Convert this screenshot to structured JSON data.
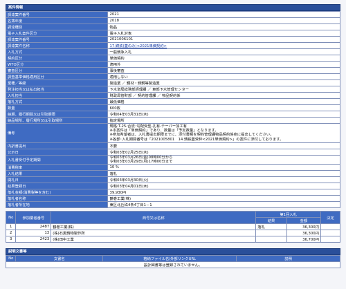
{
  "info": {
    "title": "案件情報",
    "rows": [
      {
        "label": "調達案件番号",
        "value": "2021"
      },
      {
        "label": "名簿年度",
        "value": "2018"
      },
      {
        "label": "調達種別",
        "value": "物品"
      },
      {
        "label": "電子入札案件区分",
        "value": "電子入札対象"
      },
      {
        "label": "調達案件番号",
        "value": "2021006101"
      },
      {
        "label": "調達案件名称",
        "value": "17.鋳鉄(蓋のみ)<2021単価契約>"
      },
      {
        "label": "入札方式",
        "value": "一般競争入札"
      },
      {
        "label": "契約区分",
        "value": "単価契約"
      },
      {
        "label": "WTO区分",
        "value": "適用外"
      },
      {
        "label": "審査区分",
        "value": "事後審査"
      },
      {
        "label": "調査基準価格適用区分",
        "value": "適用しない"
      },
      {
        "label": "業種／等級",
        "value": "製造業 ／ 鋼材・鋳鋼等製造業"
      },
      {
        "label": "発注担当又は払出担当",
        "value": "下水道局総務部経理課 ／ 東部下水管理センター"
      },
      {
        "label": "入札担当",
        "value": "財政局管財部 ／ 契約管理課 ／ 物品契約係"
      },
      {
        "label": "落札方式",
        "value": "最低価格"
      },
      {
        "label": "数量",
        "value": "600枚"
      },
      {
        "label": "納期、履行期間又は引取期限",
        "value": "令和04年03月31日(木)"
      },
      {
        "label": "納品場所、履行場所又は引取場所",
        "value": "指定場所"
      }
    ],
    "remarks": {
      "label": "備考",
      "lines": [
        "規格:T-25-合流･勾配受型-孔有-テーパー加工有",
        "※本案件は「単価契約」であり、数量は「予定数量」となります。",
        "※参加希望者は、入札書提出期限までに、添付書類を契約管理課物品契約係宛に提出してください。",
        "※各部･入札期間番号は「2021005801　14.鋳鉄蓋受枠<2021単価契約>」の案件に添付しております。"
      ]
    },
    "rows2": [
      {
        "label": "内訳書提出",
        "value": "不要"
      },
      {
        "label": "公示日",
        "value": "令和03年02月25日(木)"
      }
    ],
    "submission": {
      "label": "入札書受付予定期間",
      "lines": [
        "令和03年03月26日(金)08時00分から",
        "令和03年03月29日(月)17時00分まで"
      ]
    },
    "rows3": [
      {
        "label": "消費税率",
        "value": "10 %"
      },
      {
        "label": "入札結果",
        "value": "落札"
      },
      {
        "label": "開札日",
        "value": "令和03年03月30日(火)"
      },
      {
        "label": "結果登録日",
        "value": "令和03年04月01日(木)"
      },
      {
        "label": "落札金額(消費税等を含む)",
        "value": "39,930円"
      },
      {
        "label": "落札者名称",
        "value": "鶴巻工業(株)"
      },
      {
        "label": "落札者所在地",
        "value": "東区北丘珠4条4丁目1－1"
      }
    ]
  },
  "bids": {
    "headers": {
      "no": "No",
      "reg": "参加業者番号",
      "name": "商号又は名称",
      "round1": "第1回入札",
      "result": "結果",
      "amount": "金額",
      "decision": "決定"
    },
    "rows": [
      {
        "no": "1",
        "reg": "2487",
        "name": "鶴巻工業(株)",
        "result": "落札",
        "amount": "36,300円",
        "decision": ""
      },
      {
        "no": "2",
        "reg": "13",
        "name": "(株)石黒鋳物製作所",
        "result": "",
        "amount": "36,300円",
        "decision": ""
      },
      {
        "no": "3",
        "reg": "2423",
        "name": "(株)田中工業",
        "result": "",
        "amount": "36,700円",
        "decision": ""
      }
    ]
  },
  "docs": {
    "title": "説明文書等",
    "headers": {
      "no": "No",
      "name": "文書名",
      "file": "格納ファイル名/外部リンクURL",
      "desc": "説明"
    },
    "empty_message": "設計図書等は登録されていません。"
  }
}
